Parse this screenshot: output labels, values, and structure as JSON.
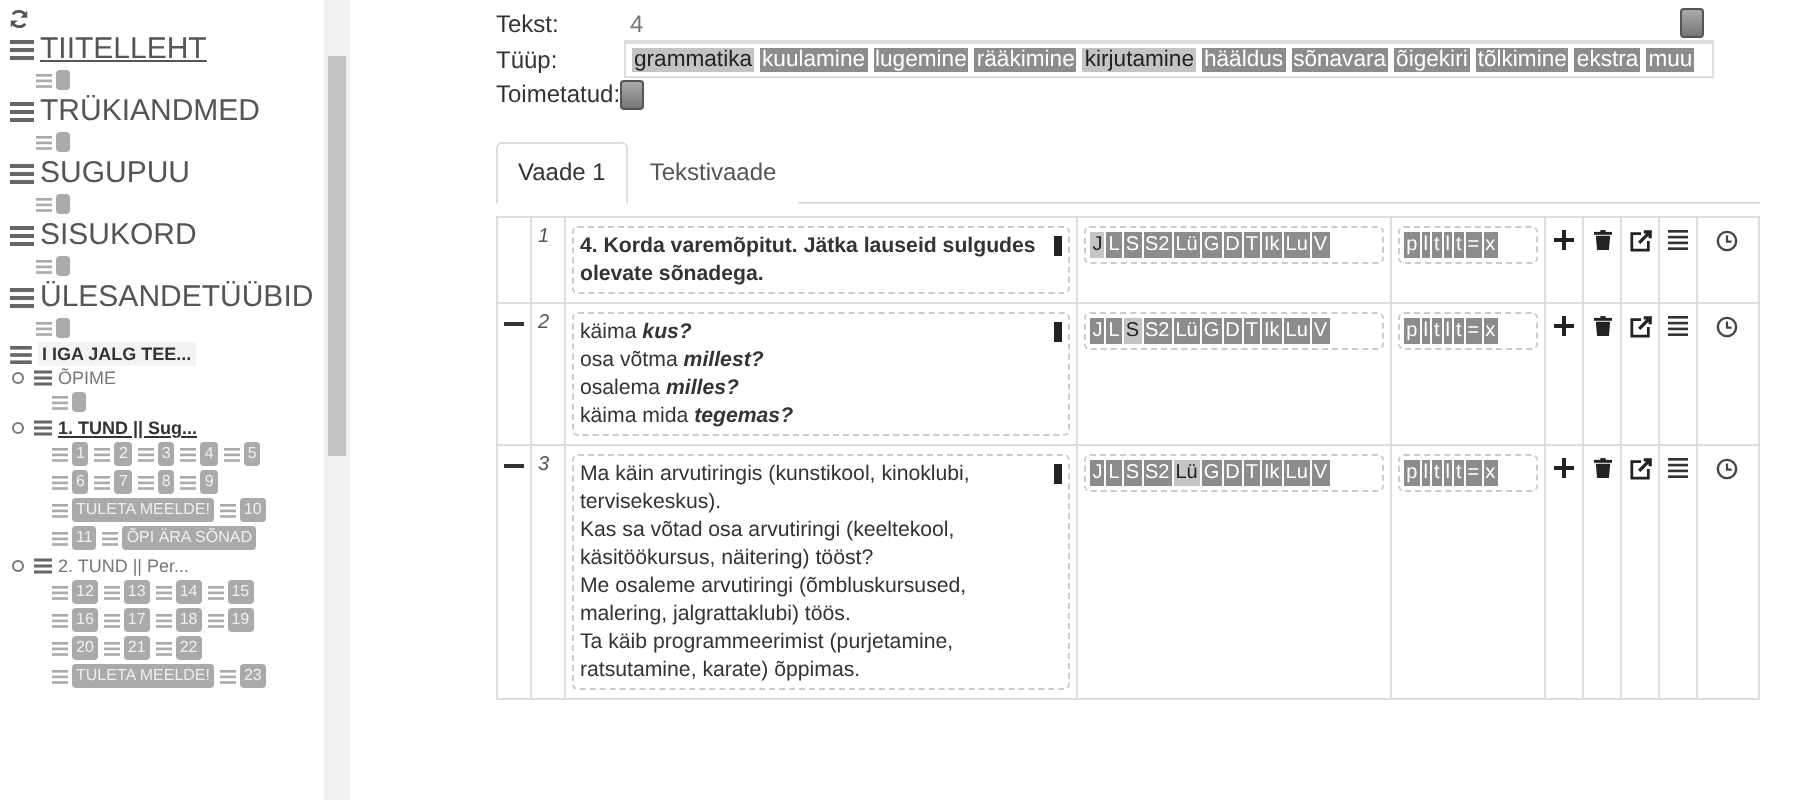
{
  "sidebar": {
    "items": [
      {
        "label": "TIITELLEHT",
        "kind": "section",
        "selected": true,
        "chips": [
          {
            "kind": "blank"
          }
        ]
      },
      {
        "label": "TRÜKIANDMED",
        "kind": "section",
        "selected": false,
        "chips": [
          {
            "kind": "blank"
          }
        ]
      },
      {
        "label": "SUGUPUU",
        "kind": "section",
        "selected": false,
        "chips": [
          {
            "kind": "blank"
          }
        ]
      },
      {
        "label": "SISUKORD",
        "kind": "section",
        "selected": false,
        "chips": [
          {
            "kind": "blank"
          }
        ]
      },
      {
        "label": "ÜLESANDETÜÜBID",
        "kind": "section",
        "selected": false,
        "chips": [
          {
            "kind": "blank"
          }
        ]
      },
      {
        "label": "I IGA JALG TEE...",
        "kind": "chapter",
        "selected": false
      },
      {
        "label": "ÕPIME",
        "kind": "lesson",
        "selected": false,
        "chips": [
          {
            "kind": "blank"
          }
        ]
      },
      {
        "label": "1. TUND || Sug...",
        "kind": "lesson",
        "selected": true,
        "chips": [
          {
            "label": "1"
          },
          {
            "label": "2"
          },
          {
            "label": "3"
          },
          {
            "label": "4"
          },
          {
            "label": "5"
          },
          {
            "label": "6"
          },
          {
            "label": "7"
          },
          {
            "label": "8"
          },
          {
            "label": "9"
          },
          {
            "label": "TULETA MEELDE!"
          },
          {
            "label": "10"
          },
          {
            "label": "11"
          },
          {
            "label": "ÕPI ÄRA SÕNAD"
          }
        ]
      },
      {
        "label": "2. TUND || Per...",
        "kind": "lesson",
        "selected": false,
        "chips": [
          {
            "label": "12"
          },
          {
            "label": "13"
          },
          {
            "label": "14"
          },
          {
            "label": "15"
          },
          {
            "label": "16"
          },
          {
            "label": "17"
          },
          {
            "label": "18"
          },
          {
            "label": "19"
          },
          {
            "label": "20"
          },
          {
            "label": "21"
          },
          {
            "label": "22"
          },
          {
            "label": "TULETA MEELDE!"
          },
          {
            "label": "23"
          }
        ]
      }
    ]
  },
  "form": {
    "text_label": "Tekst:",
    "text_value": "4",
    "type_label": "Tüüp:",
    "edited_label": "Toimetatud:",
    "edited": false,
    "types": [
      {
        "label": "grammatika",
        "selected": true
      },
      {
        "label": "kuulamine",
        "selected": false
      },
      {
        "label": "lugemine",
        "selected": false
      },
      {
        "label": "rääkimine",
        "selected": false
      },
      {
        "label": "kirjutamine",
        "selected": true
      },
      {
        "label": "hääldus",
        "selected": false
      },
      {
        "label": "sõnavara",
        "selected": false
      },
      {
        "label": "õigekiri",
        "selected": false
      },
      {
        "label": "tõlkimine",
        "selected": false
      },
      {
        "label": "ekstra",
        "selected": false
      },
      {
        "label": "muu",
        "selected": false
      }
    ]
  },
  "tabs": [
    {
      "label": "Vaade 1",
      "selected": true
    },
    {
      "label": "Tekstivaade",
      "selected": false
    }
  ],
  "rows": [
    {
      "number": "1",
      "collapsible": false,
      "bold": true,
      "lines": [
        "4. Korda varemõpitut. Jätka lauseid sulgudes olevate sõnadega."
      ],
      "skills": [
        {
          "label": "J",
          "selected": true
        },
        {
          "label": "L",
          "selected": false
        },
        {
          "label": "S",
          "selected": false
        },
        {
          "label": "S2",
          "selected": false
        },
        {
          "label": "Lü",
          "selected": false
        },
        {
          "label": "G",
          "selected": false
        },
        {
          "label": "D",
          "selected": false
        },
        {
          "label": "T",
          "selected": false
        },
        {
          "label": "Ik",
          "selected": false
        },
        {
          "label": "Lu",
          "selected": false
        },
        {
          "label": "V",
          "selected": false
        }
      ],
      "marks": [
        "p",
        "l",
        "t",
        "l",
        "t",
        "=",
        "x"
      ]
    },
    {
      "number": "2",
      "collapsible": true,
      "bold": false,
      "lines": [
        "käima **kus?**",
        "osa võtma **millest?**",
        "osalema **milles?**",
        "käima mida **tegemas?**"
      ],
      "skills": [
        {
          "label": "J",
          "selected": false
        },
        {
          "label": "L",
          "selected": false
        },
        {
          "label": "S",
          "selected": true
        },
        {
          "label": "S2",
          "selected": false
        },
        {
          "label": "Lü",
          "selected": false
        },
        {
          "label": "G",
          "selected": false
        },
        {
          "label": "D",
          "selected": false
        },
        {
          "label": "T",
          "selected": false
        },
        {
          "label": "Ik",
          "selected": false
        },
        {
          "label": "Lu",
          "selected": false
        },
        {
          "label": "V",
          "selected": false
        }
      ],
      "marks": [
        "p",
        "l",
        "t",
        "l",
        "t",
        "=",
        "x"
      ]
    },
    {
      "number": "3",
      "collapsible": true,
      "bold": false,
      "lines": [
        "Ma käin arvutiringis (kunstikool, kinoklubi, tervisekeskus).",
        "Kas sa võtad osa arvutiringi (keeltekool, käsitöökursus, näitering) tööst?",
        "Me osaleme arvutiringi (õmbluskursused, malering, jalgrattaklubi) töös.",
        "Ta käib programmeerimist (purjetamine, ratsutamine, karate) õppimas."
      ],
      "skills": [
        {
          "label": "J",
          "selected": false
        },
        {
          "label": "L",
          "selected": false
        },
        {
          "label": "S",
          "selected": false
        },
        {
          "label": "S2",
          "selected": false
        },
        {
          "label": "Lü",
          "selected": true
        },
        {
          "label": "G",
          "selected": false
        },
        {
          "label": "D",
          "selected": false
        },
        {
          "label": "T",
          "selected": false
        },
        {
          "label": "Ik",
          "selected": false
        },
        {
          "label": "Lu",
          "selected": false
        },
        {
          "label": "V",
          "selected": false
        }
      ],
      "marks": [
        "p",
        "l",
        "t",
        "l",
        "t",
        "=",
        "x"
      ]
    }
  ]
}
